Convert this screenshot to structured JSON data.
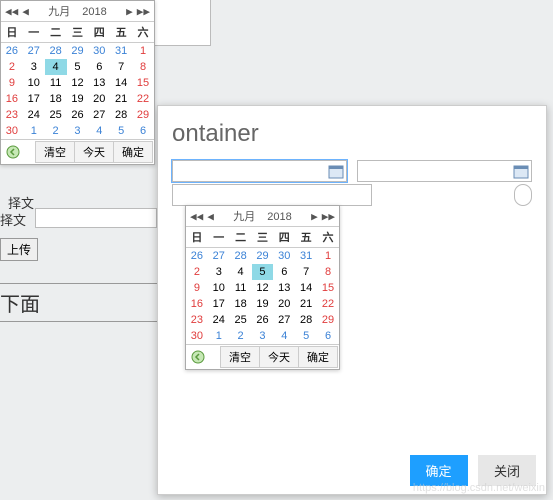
{
  "background": {
    "input_top": "",
    "label1": "择文",
    "label2": "择文",
    "btn_upload": "上传",
    "heading": "下面"
  },
  "modal": {
    "title_partial": "ontainer",
    "footer": {
      "ok": "确定",
      "close": "关闭"
    }
  },
  "datepicker_common": {
    "nav_pp": "◀◀",
    "nav_p": "◀",
    "nav_n": "▶",
    "nav_nn": "▶▶",
    "month": "九月",
    "year": "2018",
    "dow": [
      "日",
      "一",
      "二",
      "三",
      "四",
      "五",
      "六"
    ],
    "btn_clear": "清空",
    "btn_today": "今天",
    "btn_ok": "确定"
  },
  "dp1": {
    "selected": 4,
    "weeks": [
      [
        {
          "d": 26,
          "o": 1
        },
        {
          "d": 27,
          "o": 1
        },
        {
          "d": 28,
          "o": 1
        },
        {
          "d": 29,
          "o": 1
        },
        {
          "d": 30,
          "o": 1
        },
        {
          "d": 31,
          "o": 1
        },
        {
          "d": 1
        }
      ],
      [
        {
          "d": 2
        },
        {
          "d": 3
        },
        {
          "d": 4,
          "sel": 1
        },
        {
          "d": 5
        },
        {
          "d": 6
        },
        {
          "d": 7
        },
        {
          "d": 8
        }
      ],
      [
        {
          "d": 9
        },
        {
          "d": 10
        },
        {
          "d": 11
        },
        {
          "d": 12
        },
        {
          "d": 13
        },
        {
          "d": 14
        },
        {
          "d": 15
        }
      ],
      [
        {
          "d": 16
        },
        {
          "d": 17
        },
        {
          "d": 18
        },
        {
          "d": 19
        },
        {
          "d": 20
        },
        {
          "d": 21
        },
        {
          "d": 22
        }
      ],
      [
        {
          "d": 23
        },
        {
          "d": 24
        },
        {
          "d": 25
        },
        {
          "d": 26
        },
        {
          "d": 27
        },
        {
          "d": 28
        },
        {
          "d": 29
        }
      ],
      [
        {
          "d": 30
        },
        {
          "d": 1,
          "o": 1
        },
        {
          "d": 2,
          "o": 1
        },
        {
          "d": 3,
          "o": 1
        },
        {
          "d": 4,
          "o": 1
        },
        {
          "d": 5,
          "o": 1
        },
        {
          "d": 6,
          "o": 1
        }
      ]
    ]
  },
  "dp2": {
    "selected": 5,
    "weeks": [
      [
        {
          "d": 26,
          "o": 1
        },
        {
          "d": 27,
          "o": 1
        },
        {
          "d": 28,
          "o": 1
        },
        {
          "d": 29,
          "o": 1
        },
        {
          "d": 30,
          "o": 1
        },
        {
          "d": 31,
          "o": 1
        },
        {
          "d": 1
        }
      ],
      [
        {
          "d": 2
        },
        {
          "d": 3
        },
        {
          "d": 4
        },
        {
          "d": 5,
          "sel": 1
        },
        {
          "d": 6
        },
        {
          "d": 7
        },
        {
          "d": 8
        }
      ],
      [
        {
          "d": 9
        },
        {
          "d": 10
        },
        {
          "d": 11
        },
        {
          "d": 12
        },
        {
          "d": 13
        },
        {
          "d": 14
        },
        {
          "d": 15
        }
      ],
      [
        {
          "d": 16
        },
        {
          "d": 17
        },
        {
          "d": 18
        },
        {
          "d": 19
        },
        {
          "d": 20
        },
        {
          "d": 21
        },
        {
          "d": 22
        }
      ],
      [
        {
          "d": 23
        },
        {
          "d": 24
        },
        {
          "d": 25
        },
        {
          "d": 26
        },
        {
          "d": 27
        },
        {
          "d": 28
        },
        {
          "d": 29
        }
      ],
      [
        {
          "d": 30
        },
        {
          "d": 1,
          "o": 1
        },
        {
          "d": 2,
          "o": 1
        },
        {
          "d": 3,
          "o": 1
        },
        {
          "d": 4,
          "o": 1
        },
        {
          "d": 5,
          "o": 1
        },
        {
          "d": 6,
          "o": 1
        }
      ]
    ]
  },
  "watermark": "https://blog.csdn.net/weixin"
}
